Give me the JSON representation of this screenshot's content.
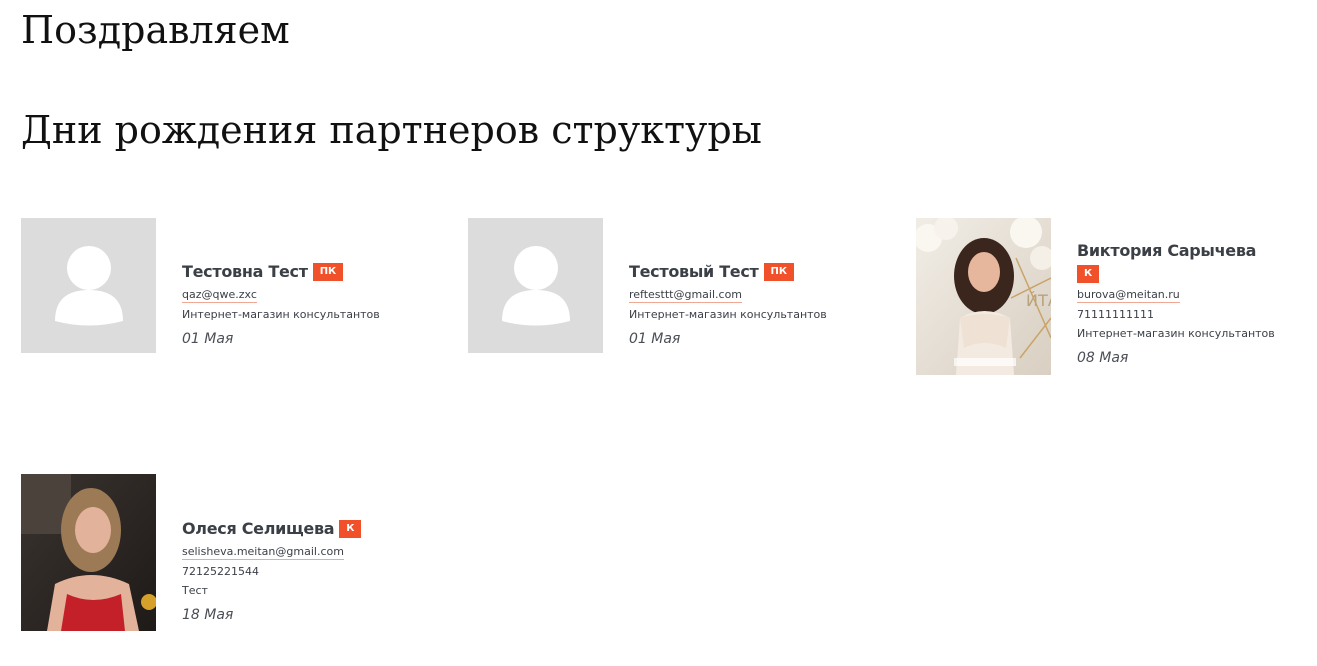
{
  "page": {
    "title": "Поздравляем",
    "section_title": "Дни рождения партнеров структуры"
  },
  "colors": {
    "badge": "#f0512a",
    "placeholder_bg": "#dcdcdc",
    "text": "#3b3f46"
  },
  "partners": [
    {
      "name": "Тестовна Тест",
      "badge": "ПК",
      "email": "qaz@qwe.zxc",
      "phone": "",
      "shop": "Интернет-магазин консультантов",
      "date": "01 Мая",
      "photo": "avatar-placeholder-icon"
    },
    {
      "name": "Тестовый Тест",
      "badge": "ПК",
      "email": "reftesttt@gmail.com",
      "phone": "",
      "shop": "Интернет-магазин консультантов",
      "date": "01 Мая",
      "photo": "avatar-placeholder-icon"
    },
    {
      "name": "Виктория Сарычева",
      "badge": "К",
      "email": "burova@meitan.ru",
      "phone": "71111111111",
      "shop": "Интернет-магазин консультантов",
      "date": "08 Мая",
      "photo": "user-photo"
    },
    {
      "name": "Олеся Селищева",
      "badge": "К",
      "email": "selisheva.meitan@gmail.com",
      "phone": "72125221544",
      "shop": "Тест",
      "date": "18 Мая",
      "photo": "user-photo"
    }
  ]
}
